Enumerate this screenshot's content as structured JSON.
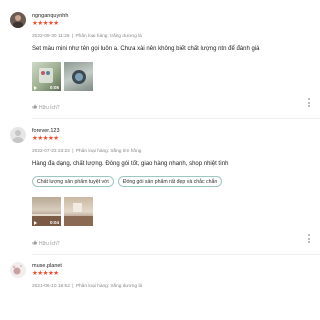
{
  "reviews": [
    {
      "username": "ngnganquynhh",
      "rating": 5,
      "stars": "★★★★★",
      "date": "2022-09-30 11:26",
      "separator": "|",
      "variation": "Phân loại hàng: trắng dương lá",
      "comment": "Set màu mini như tên gọi luôn a. Chưa xài nên không biết chất lượng ntn để đánh giá",
      "tags": [],
      "media": [
        {
          "type": "video",
          "duration": "0:05"
        },
        {
          "type": "image",
          "duration": ""
        }
      ],
      "helpful_label": "Hữu Ích?"
    },
    {
      "username": "forever.123",
      "rating": 5,
      "stars": "★★★★★",
      "date": "2022-07-23 23:22",
      "separator": "|",
      "variation": "Phân loại hàng: trắng tím hồng",
      "comment": "Hàng đa dạng, chất lượng. Đóng gói tốt, giao hàng nhanh, shop nhiệt tình",
      "tags": [
        "Chất lượng sản phẩm tuyệt vời",
        "Đóng gói sản phẩm rất đẹp và chắc chắn"
      ],
      "media": [
        {
          "type": "video",
          "duration": "0:04"
        },
        {
          "type": "image",
          "duration": ""
        }
      ],
      "helpful_label": "Hữu Ích?"
    },
    {
      "username": "muse.planet",
      "rating": 5,
      "stars": "★★★★★",
      "date": "2021-06-10 18:52",
      "separator": "|",
      "variation": "Phân loại hàng: trắng dương lá",
      "comment": "",
      "tags": [],
      "media": [],
      "helpful_label": ""
    }
  ],
  "colors": {
    "star": "#ee4d2d",
    "tag_border": "#9dc7c2",
    "meta": "#888888"
  }
}
